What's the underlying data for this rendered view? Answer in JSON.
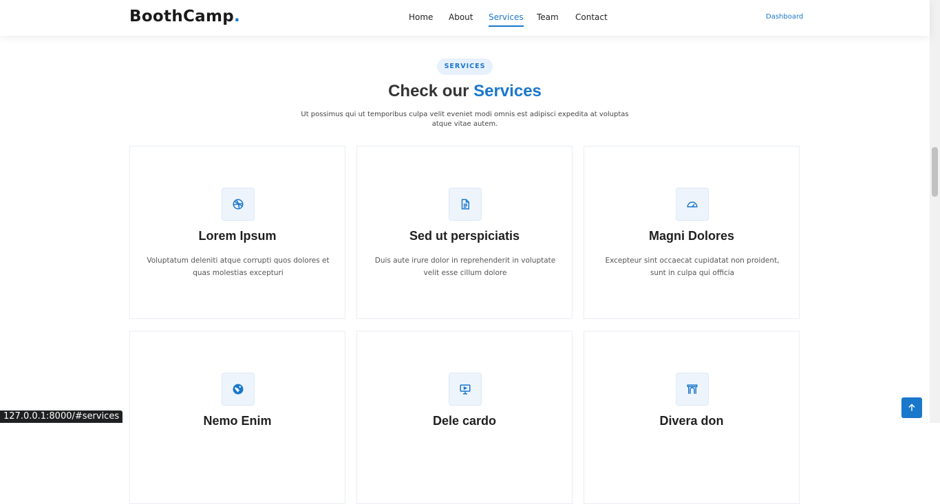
{
  "header": {
    "logo": "BoothCamp",
    "logo_dot": ".",
    "nav": [
      {
        "label": "Home"
      },
      {
        "label": "About"
      },
      {
        "label": "Services"
      },
      {
        "label": "Team"
      },
      {
        "label": "Contact"
      }
    ],
    "dashboard": "Dashboard"
  },
  "section": {
    "badge": "SERVICES",
    "title_prefix": "Check our",
    "title_accent": "Services",
    "lead": "Ut possimus qui ut temporibus culpa velit eveniet modi omnis est adipisci expedita at voluptas atque vitae autem."
  },
  "cards": [
    {
      "title": "Lorem Ipsum",
      "text": "Voluptatum deleniti atque corrupti quos dolores et quas molestias excepturi",
      "icon": "dribbble-icon"
    },
    {
      "title": "Sed ut perspiciatis",
      "text": "Duis aute irure dolor in reprehenderit in voluptate velit esse cillum dolore",
      "icon": "file-text-icon"
    },
    {
      "title": "Magni Dolores",
      "text": "Excepteur sint occaecat cupidatat non proident, sunt in culpa qui officia",
      "icon": "speedometer-icon"
    },
    {
      "title": "Nemo Enim",
      "text": "",
      "icon": "globe-icon"
    },
    {
      "title": "Dele cardo",
      "text": "",
      "icon": "easel-icon"
    },
    {
      "title": "Divera don",
      "text": "",
      "icon": "arch-icon"
    }
  ],
  "status_url": "127.0.0.1:8000/#services",
  "colors": {
    "accent": "#1977cc",
    "heading": "#333333"
  }
}
